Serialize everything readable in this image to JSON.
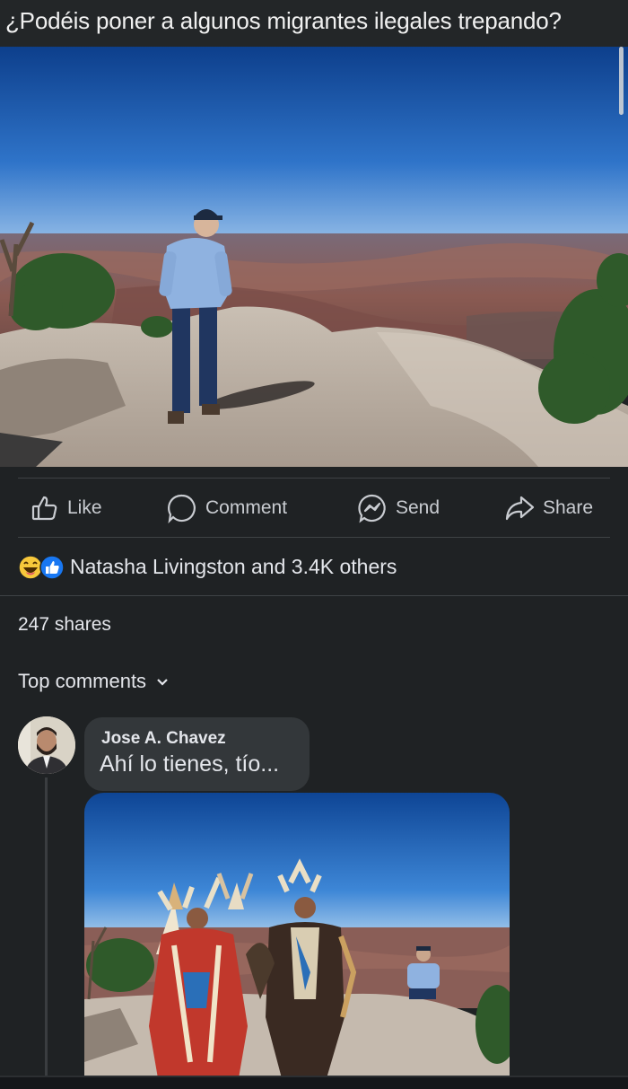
{
  "post": {
    "title": "¿Podéis poner a algunos migrantes ilegales trepando?"
  },
  "actions": {
    "like": "Like",
    "comment": "Comment",
    "send": "Send",
    "share": "Share"
  },
  "reactions": {
    "icons": [
      "laugh-emoji-icon",
      "like-reaction-icon"
    ],
    "summary": "Natasha Livingston and 3.4K others"
  },
  "shares": "247 shares",
  "comments_sort": {
    "label": "Top comments",
    "icon": "chevron-down-icon"
  },
  "comment": {
    "author": "Jose A. Chavez",
    "text": "Ahí lo tienes, tío..."
  },
  "colors": {
    "background": "#1f2224",
    "bubble": "#33373a",
    "text": "#e4e6eb",
    "like_blue": "#1877f2",
    "laugh_yellow": "#f7c83b"
  }
}
